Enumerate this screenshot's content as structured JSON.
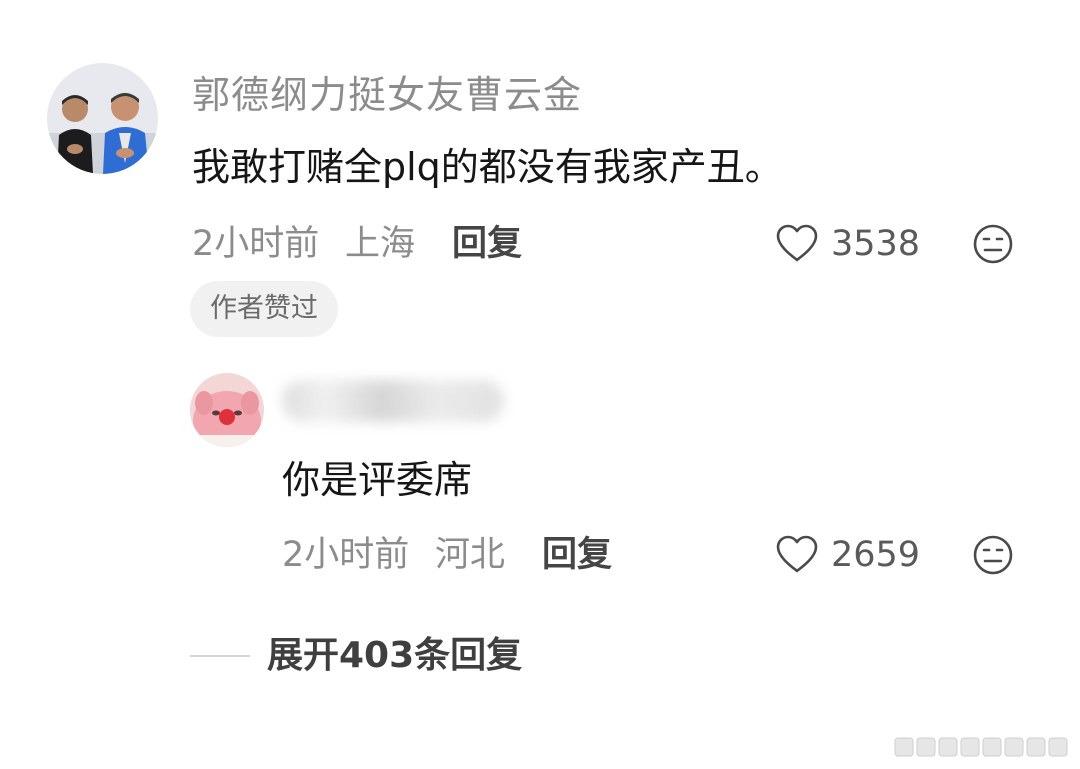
{
  "comment": {
    "username": "郭德纲力挺女友曹云金",
    "text": "我敢打赌全plq的都没有我家产丑。",
    "time": "2小时前",
    "location": "上海",
    "reply_label": "回复",
    "likes": "3538",
    "badge": "作者赞过"
  },
  "reply": {
    "text": "你是评委席",
    "time": "2小时前",
    "location": "河北",
    "reply_label": "回复",
    "likes": "2659"
  },
  "expand": {
    "label": "展开403条回复"
  },
  "icons": {
    "like": "heart-outline-icon",
    "dislike": "meh-face-icon"
  },
  "colors": {
    "meta_gray": "#8c8c8c",
    "text_dark": "#161616",
    "badge_bg": "#f1f1f1"
  }
}
